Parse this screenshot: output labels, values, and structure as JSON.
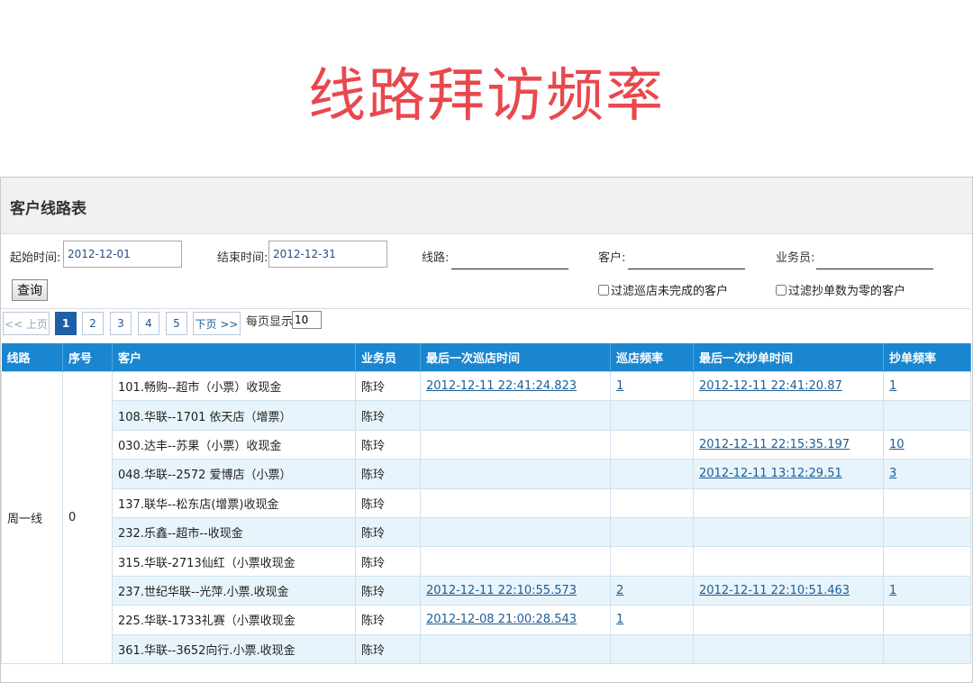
{
  "page_title": "线路拜访频率",
  "panel": {
    "title": "客户线路表",
    "filters": {
      "start_label": "起始时间:",
      "start_value": "2012-12-01",
      "end_label": "结束时间:",
      "end_value": "2012-12-31",
      "route_label": "线路:",
      "customer_label": "客户:",
      "salesman_label": "业务员:",
      "query_button": "查询",
      "filter_incomplete": "过滤巡店未完成的客户",
      "filter_zero_orders": "过滤抄单数为零的客户"
    },
    "pager": {
      "prev": "<< 上页",
      "pages": [
        "1",
        "2",
        "3",
        "4",
        "5"
      ],
      "active_page": "1",
      "next": "下页 >>",
      "per_page_label": "每页显示",
      "per_page_value": "10"
    },
    "table": {
      "columns": [
        "线路",
        "序号",
        "客户",
        "业务员",
        "最后一次巡店时间",
        "巡店频率",
        "最后一次抄单时间",
        "抄单频率"
      ],
      "route": "周一线",
      "seq": "0",
      "rows": [
        {
          "customer": "101.畅购--超市（小票）收现金",
          "salesman": "陈玲",
          "last_visit": "2012-12-11 22:41:24.823",
          "visit_freq": "1",
          "last_order": "2012-12-11 22:41:20.87",
          "order_freq": "1"
        },
        {
          "customer": "108.华联--1701 依天店（增票）",
          "salesman": "陈玲",
          "last_visit": "",
          "visit_freq": "",
          "last_order": "",
          "order_freq": ""
        },
        {
          "customer": "030.达丰--苏果（小票）收现金",
          "salesman": "陈玲",
          "last_visit": "",
          "visit_freq": "",
          "last_order": "2012-12-11 22:15:35.197",
          "order_freq": "10"
        },
        {
          "customer": "048.华联--2572 爱博店（小票）",
          "salesman": "陈玲",
          "last_visit": "",
          "visit_freq": "",
          "last_order": "2012-12-11 13:12:29.51",
          "order_freq": "3"
        },
        {
          "customer": "137.联华--松东店(增票)收现金",
          "salesman": "陈玲",
          "last_visit": "",
          "visit_freq": "",
          "last_order": "",
          "order_freq": ""
        },
        {
          "customer": "232.乐鑫--超市--收现金",
          "salesman": "陈玲",
          "last_visit": "",
          "visit_freq": "",
          "last_order": "",
          "order_freq": ""
        },
        {
          "customer": "315.华联-2713仙红（小票收现金",
          "salesman": "陈玲",
          "last_visit": "",
          "visit_freq": "",
          "last_order": "",
          "order_freq": ""
        },
        {
          "customer": "237.世纪华联--光萍.小票.收现金",
          "salesman": "陈玲",
          "last_visit": "2012-12-11 22:10:55.573",
          "visit_freq": "2",
          "last_order": "2012-12-11 22:10:51.463",
          "order_freq": "1"
        },
        {
          "customer": "225.华联-1733礼赛（小票收现金",
          "salesman": "陈玲",
          "last_visit": "2012-12-08 21:00:28.543",
          "visit_freq": "1",
          "last_order": "",
          "order_freq": ""
        },
        {
          "customer": "361.华联--3652向行.小票.收现金",
          "salesman": "陈玲",
          "last_visit": "",
          "visit_freq": "",
          "last_order": "",
          "order_freq": ""
        }
      ]
    }
  }
}
